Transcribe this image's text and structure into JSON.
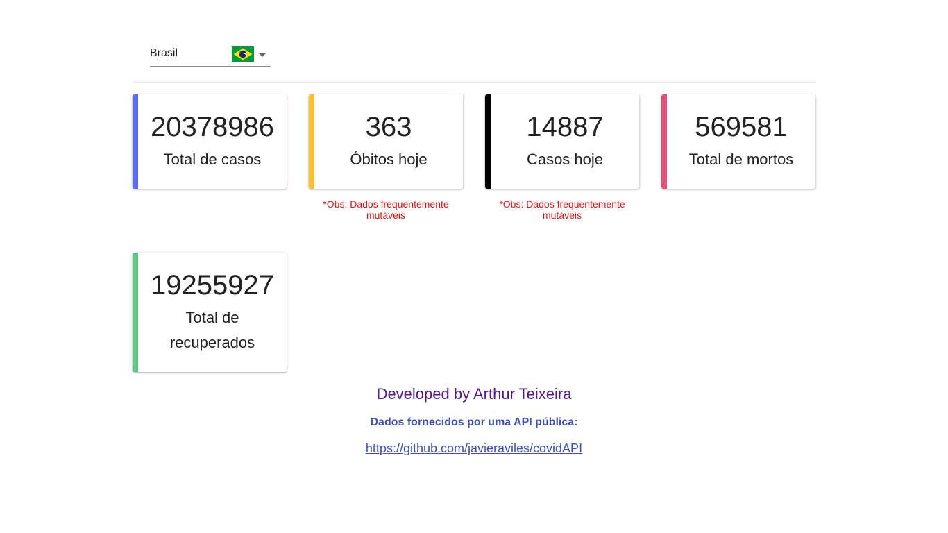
{
  "country_select": {
    "value": "Brasil",
    "flag_icon": "brazil-flag-icon"
  },
  "cards": [
    {
      "value": "20378986",
      "label": "Total de casos",
      "color": "#5c6cf0"
    },
    {
      "value": "363",
      "label": "Óbitos hoje",
      "color": "#f9bf2f"
    },
    {
      "value": "14887",
      "label": "Casos hoje",
      "color": "#000000"
    },
    {
      "value": "569581",
      "label": "Total de mortos",
      "color": "#e4507a"
    },
    {
      "value": "19255927",
      "label": "Total de recuperados",
      "color": "#63c583"
    }
  ],
  "notes": {
    "obitos_hoje": "*Obs: Dados frequentemente mutáveis",
    "casos_hoje": "*Obs: Dados frequentemente mutáveis"
  },
  "footer": {
    "developer": "Developed by Arthur Teixeira",
    "source_label": "Dados fornecidos por uma API pública:",
    "link": "https://github.com/javieraviles/covidAPI"
  }
}
